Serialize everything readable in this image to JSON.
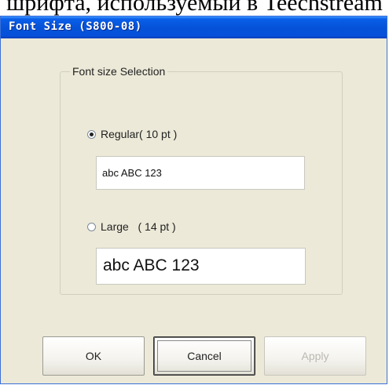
{
  "page": {
    "background_caption": "шрифта, используемый в Teechstream"
  },
  "window": {
    "title": "Font Size (S800-08)",
    "title_bar_color": "#0553d8"
  },
  "group": {
    "legend": "Font size Selection"
  },
  "options": {
    "regular": {
      "label": "Regular( 10 pt )",
      "selected": true,
      "sample_text": "abc ABC 123"
    },
    "large": {
      "label": "Large   ( 14 pt )",
      "selected": false,
      "sample_text": "abc ABC 123"
    }
  },
  "buttons": {
    "ok": "OK",
    "cancel": "Cancel",
    "apply": "Apply"
  }
}
